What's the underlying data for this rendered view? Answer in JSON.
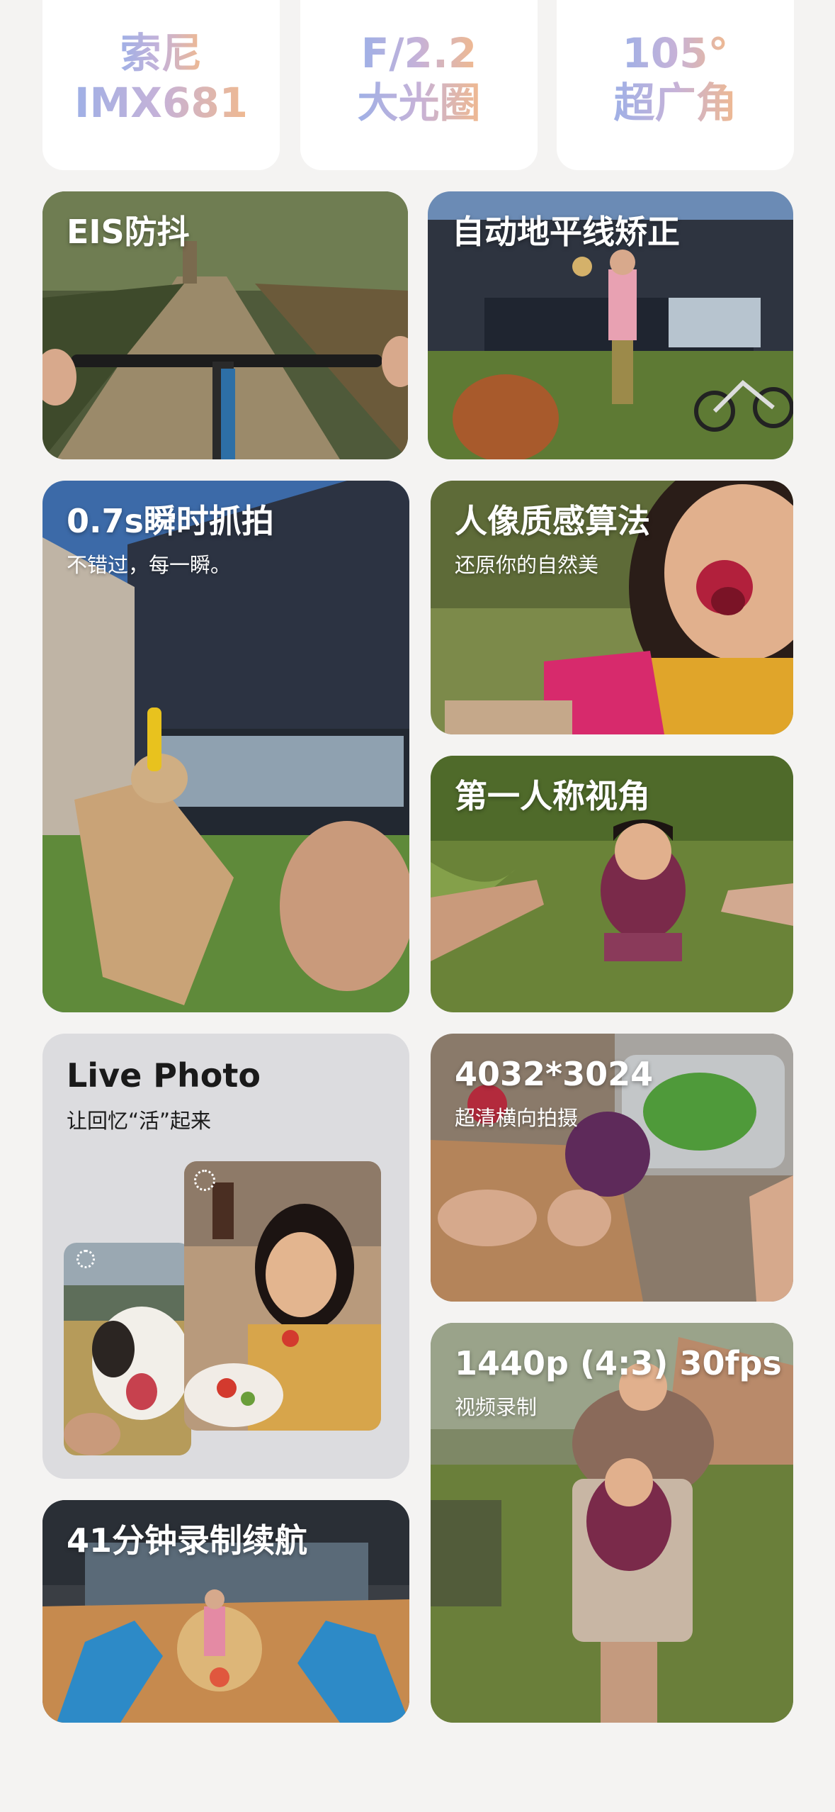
{
  "specs": [
    {
      "line1": "索尼",
      "line2": "IMX681"
    },
    {
      "line1": "F/2.2",
      "line2": "大光圈"
    },
    {
      "line1": "105°",
      "line2": "超广角"
    }
  ],
  "cards": {
    "eis": {
      "title": "EIS防抖"
    },
    "horizon": {
      "title": "自动地平线矫正"
    },
    "snap": {
      "title": "0.7s瞬时抓拍",
      "subtitle": "不错过，每一瞬。"
    },
    "portrait": {
      "title": "人像质感算法",
      "subtitle": "还原你的自然美"
    },
    "first_person": {
      "title": "第一人称视角"
    },
    "live_photo": {
      "title": "Live Photo",
      "subtitle": "让回忆“活”起来"
    },
    "resolution": {
      "title": "4032*3024",
      "subtitle": "超清横向拍摄"
    },
    "video": {
      "title": "1440p (4:3) 30fps",
      "subtitle": "视频录制"
    },
    "battery": {
      "title": "41分钟录制续航"
    }
  }
}
